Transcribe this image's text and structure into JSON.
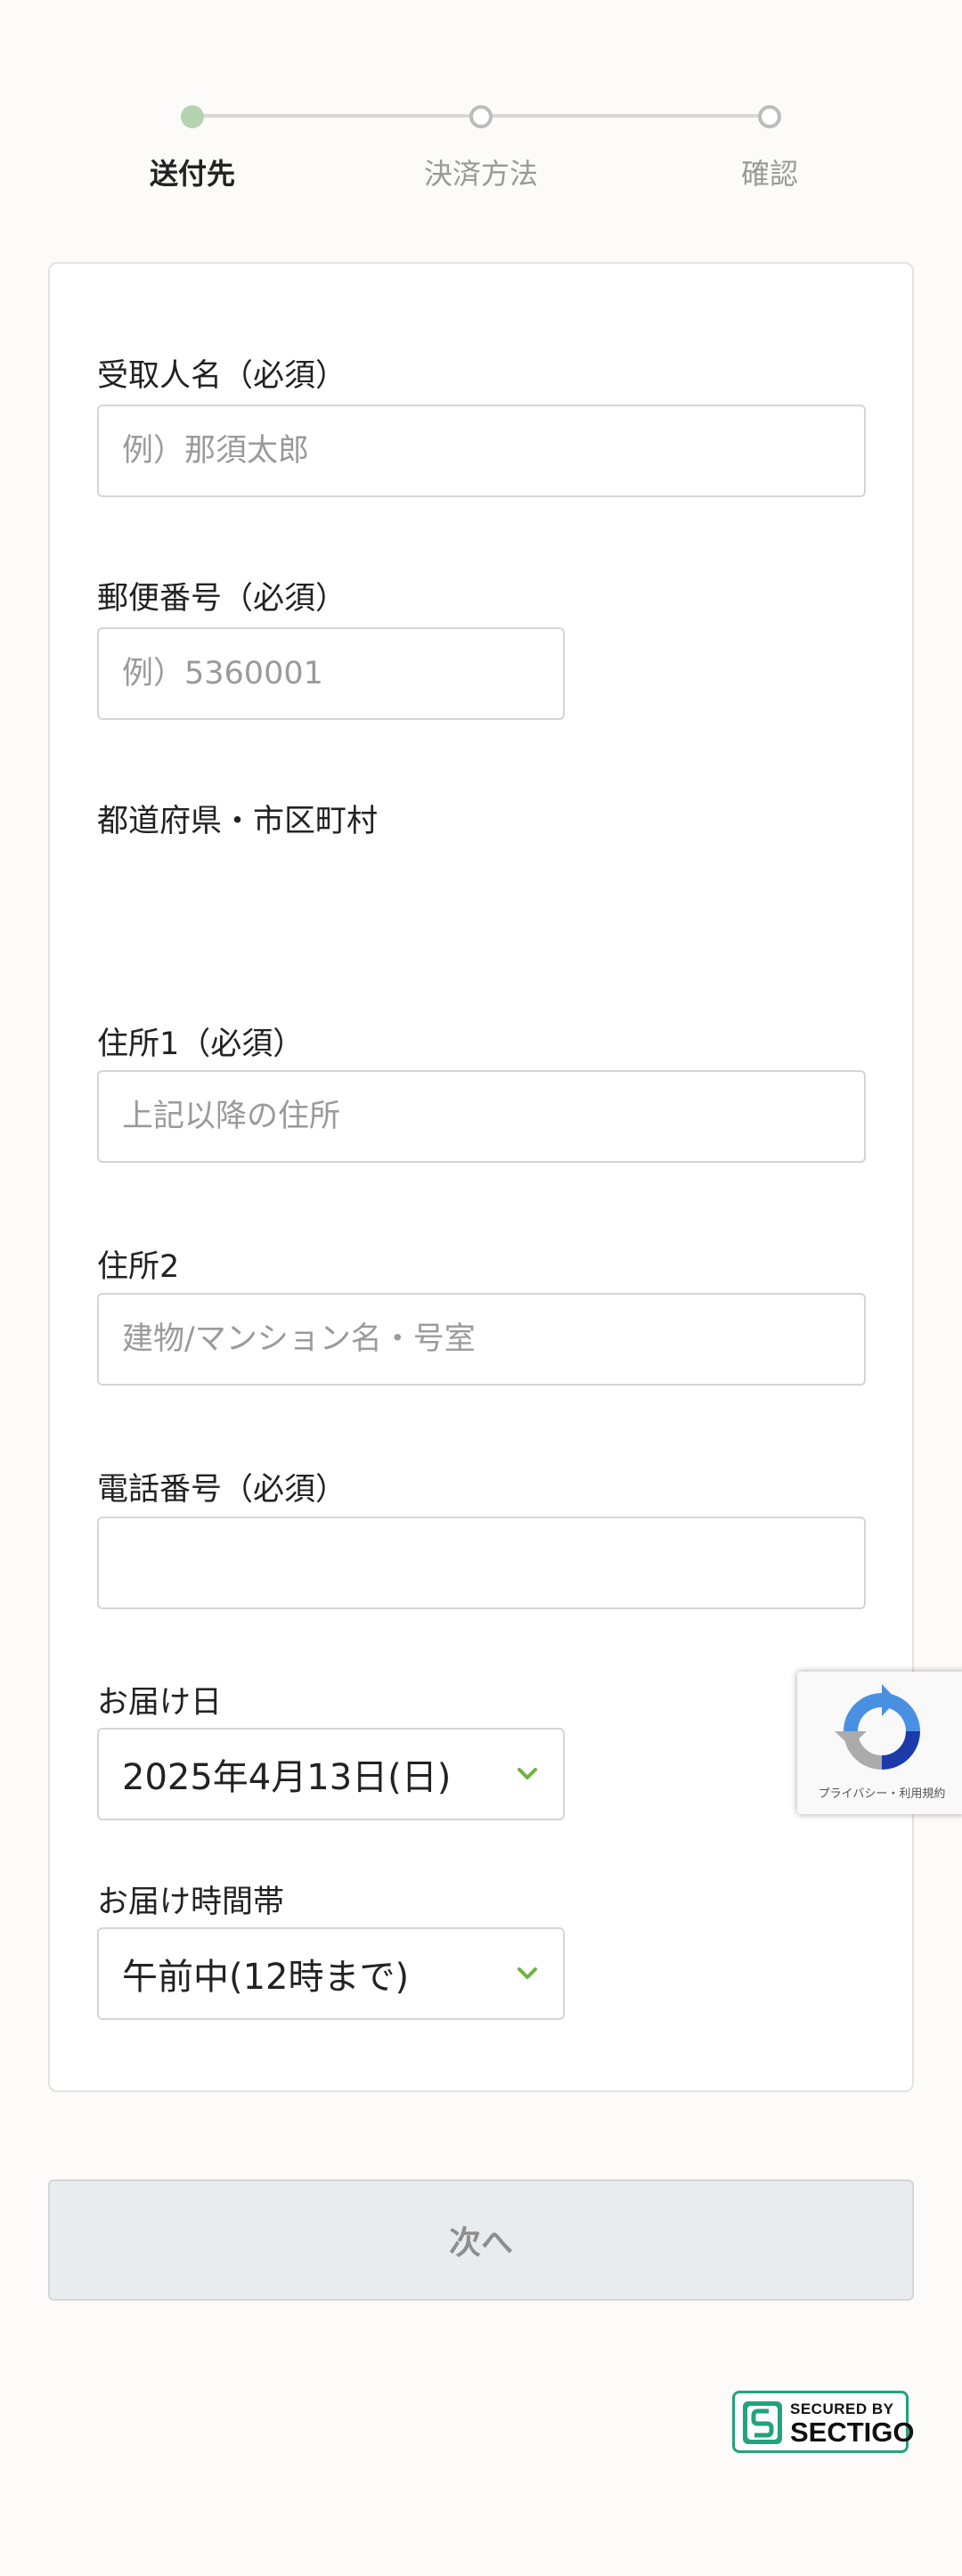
{
  "steps": [
    {
      "label": "送付先",
      "active": true
    },
    {
      "label": "決済方法",
      "active": false
    },
    {
      "label": "確認",
      "active": false
    }
  ],
  "form": {
    "recipient_name": {
      "label": "受取人名（必須）",
      "placeholder": "例）那須太郎",
      "value": ""
    },
    "postal_code": {
      "label": "郵便番号（必須）",
      "placeholder": "例）5360001",
      "value": ""
    },
    "prefecture_city": {
      "label": "都道府県・市区町村",
      "value": ""
    },
    "address1": {
      "label": "住所1（必須）",
      "placeholder": "上記以降の住所",
      "value": ""
    },
    "address2": {
      "label": "住所2",
      "placeholder": "建物/マンション名・号室",
      "value": ""
    },
    "phone": {
      "label": "電話番号（必須）",
      "placeholder": "",
      "value": ""
    },
    "delivery_date": {
      "label": "お届け日",
      "selected": "2025年4月13日(日)"
    },
    "delivery_time": {
      "label": "お届け時間帯",
      "selected": "午前中(12時まで)"
    }
  },
  "recaptcha": {
    "terms": "プライバシー・利用規約"
  },
  "next_button": {
    "label": "次へ"
  },
  "sectigo": {
    "line1": "SECURED BY",
    "line2": "SECTIGO"
  },
  "colors": {
    "accent_green": "#6db33f",
    "step_active": "#b6d3af",
    "sectigo_green": "#23a27c",
    "button_bg": "#e9ecee"
  }
}
